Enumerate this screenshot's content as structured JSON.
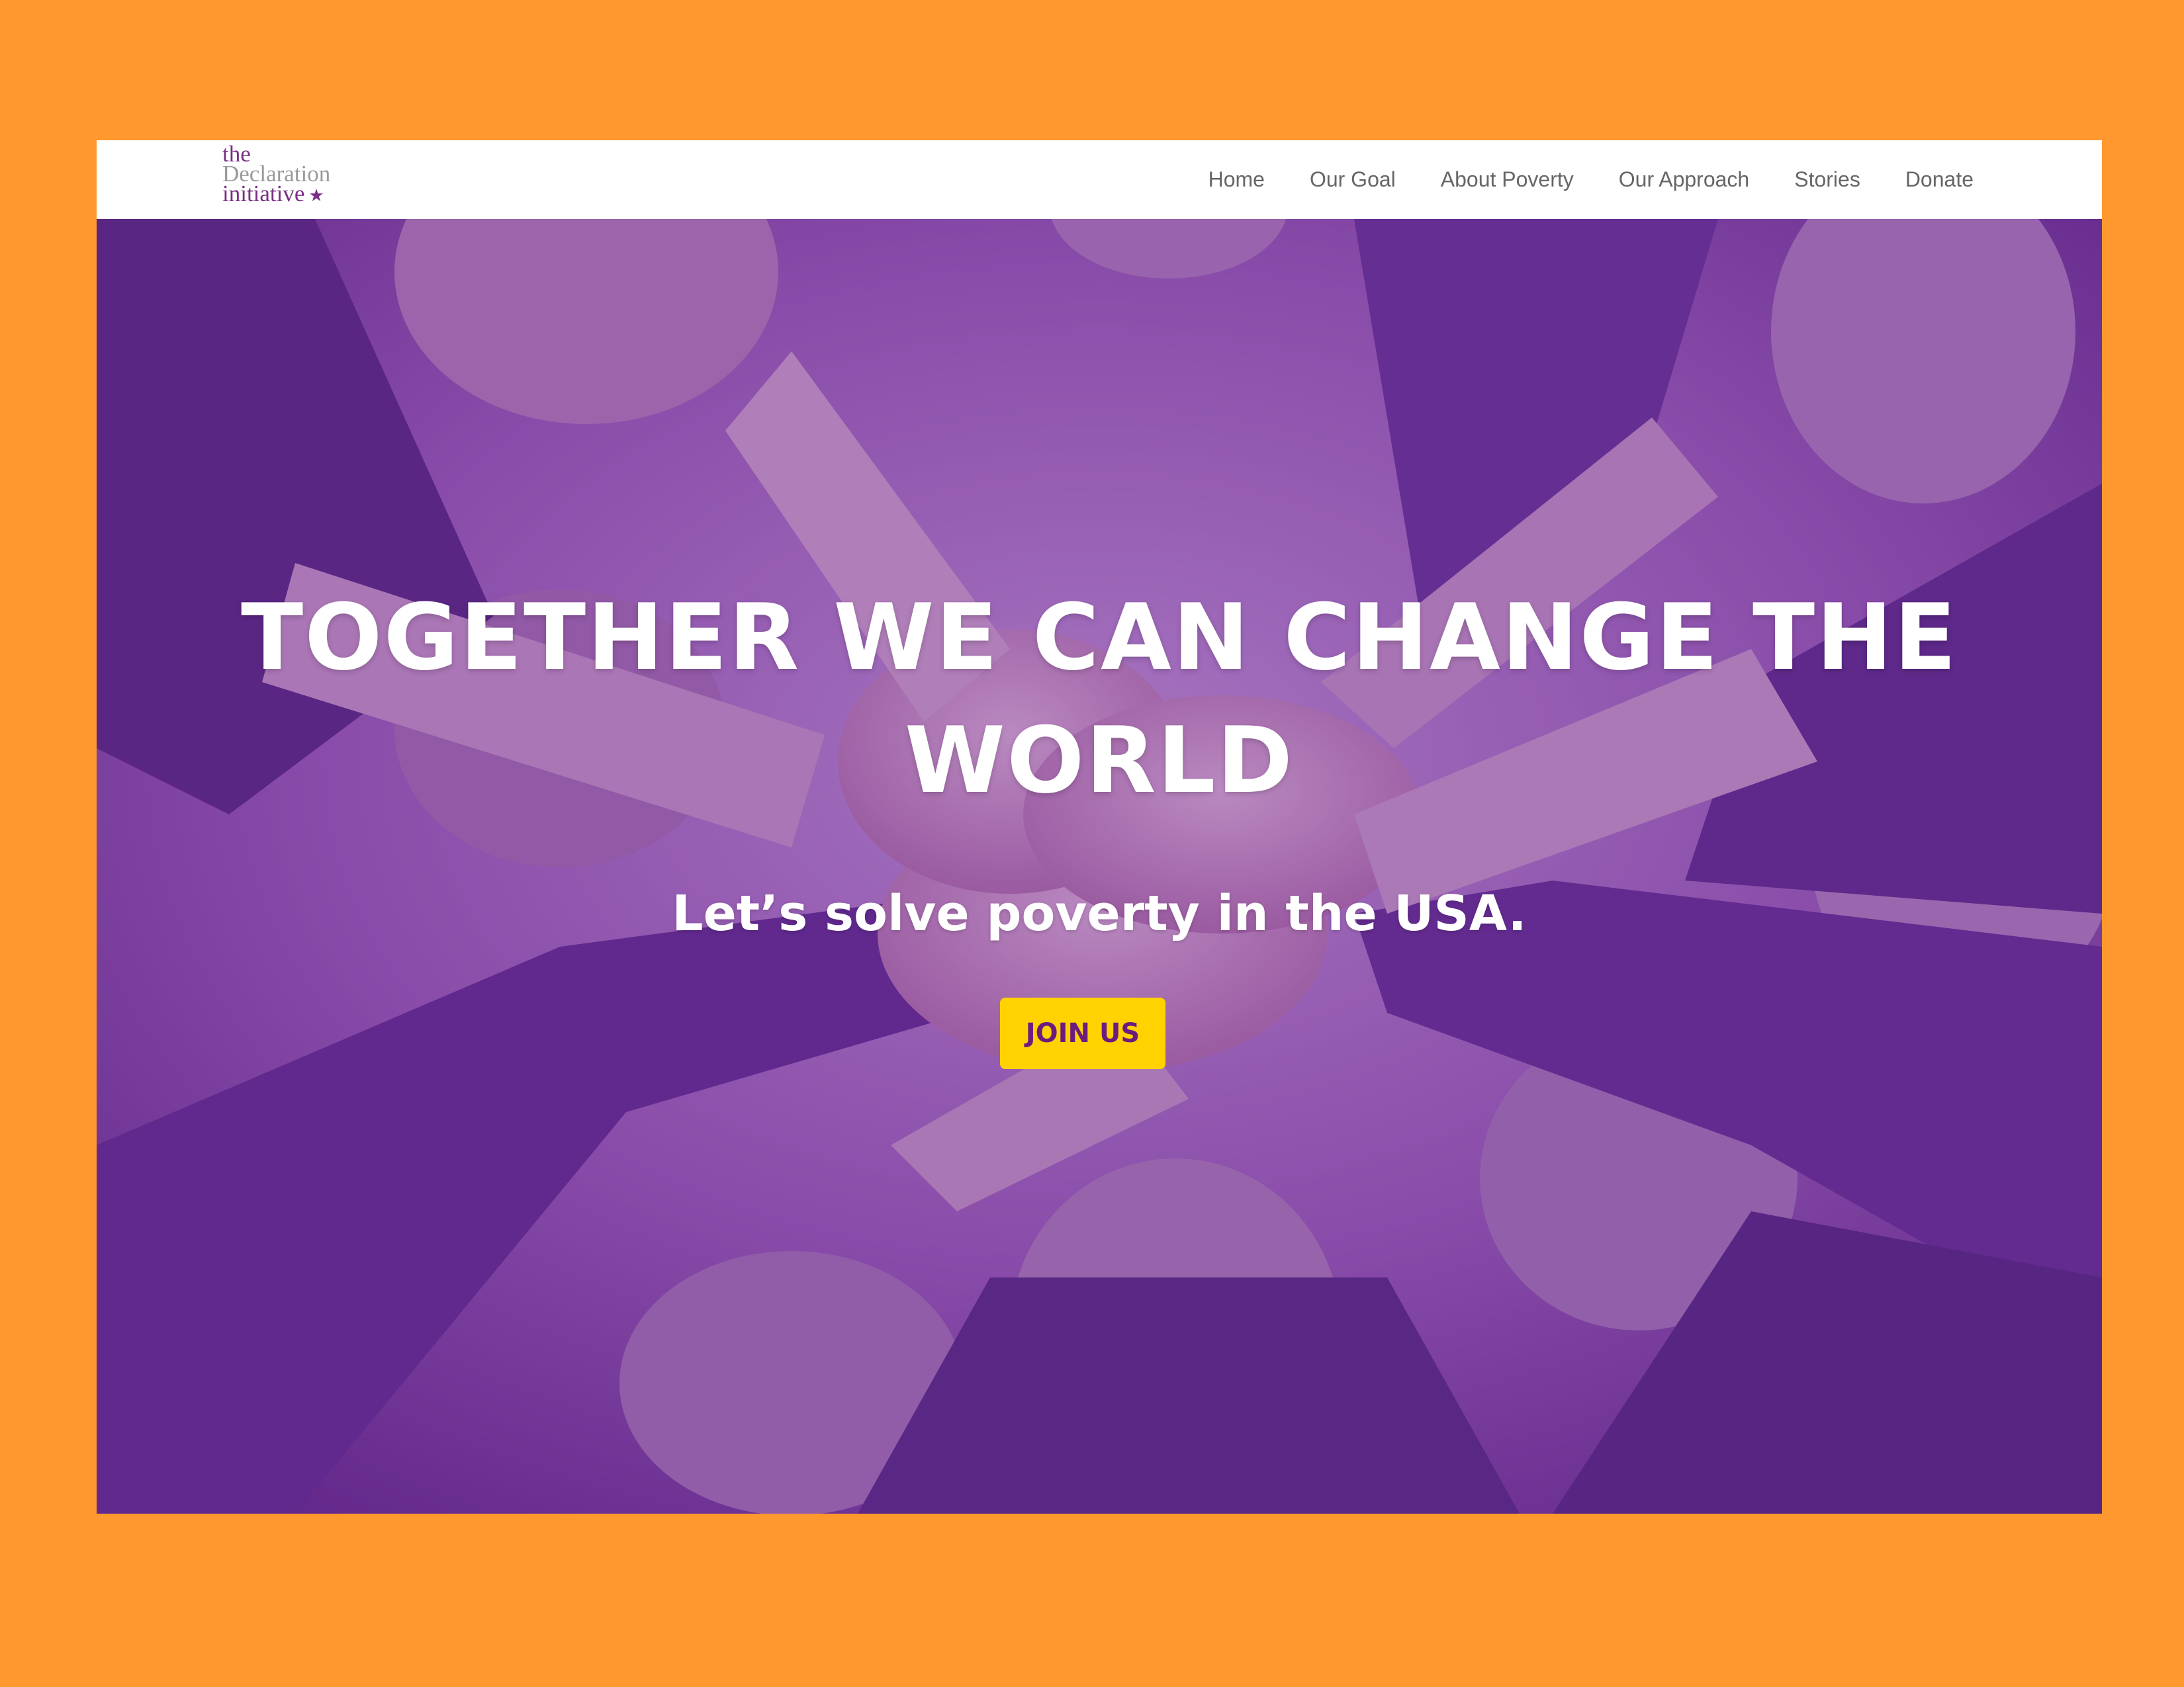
{
  "logo": {
    "line1": "the",
    "line2": "Declaration",
    "line3": "initiative",
    "star": "★"
  },
  "nav": {
    "items": [
      "Home",
      "Our Goal",
      "About Poverty",
      "Our Approach",
      "Stories",
      "Donate"
    ]
  },
  "hero": {
    "headline": "TOGETHER WE CAN CHANGE THE WORLD",
    "subheadline": "Let’s solve poverty in the USA.",
    "button_label": "JOIN US",
    "background_image": "hands-stacked-circle-photo",
    "overlay_color": "#6E2896"
  },
  "colors": {
    "page_border": "#FF982E",
    "brand_purple": "#7A2F86",
    "button_yellow": "#FFD200",
    "button_text": "#6B1C7E",
    "nav_text": "#666666"
  }
}
